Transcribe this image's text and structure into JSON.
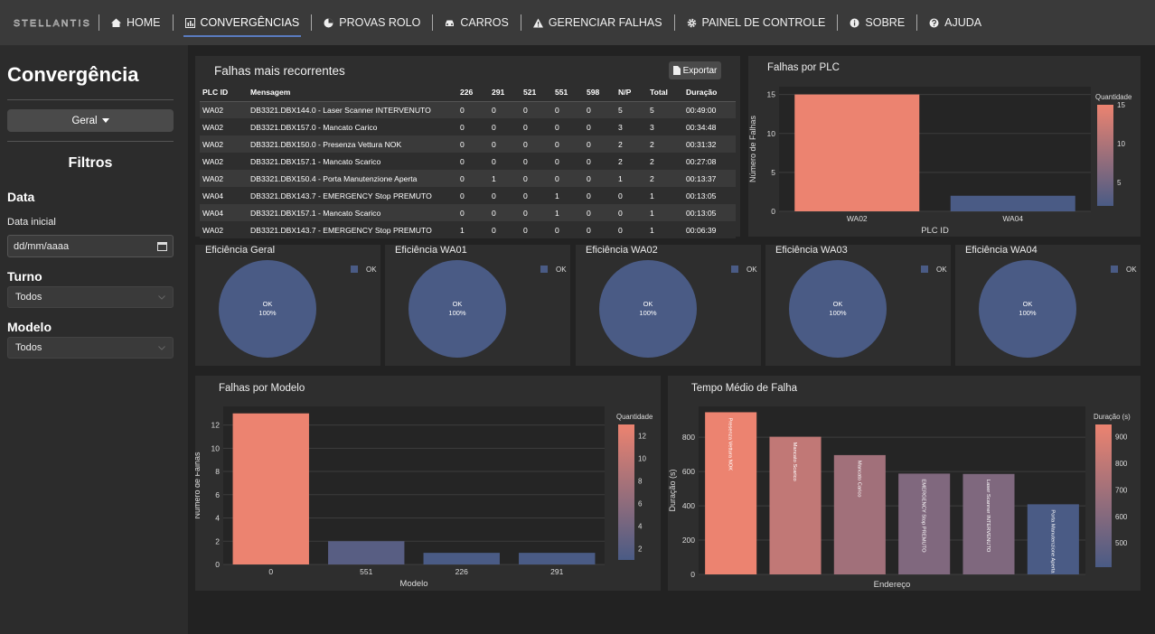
{
  "nav": {
    "logo_text": "STELLANTIS",
    "items": [
      {
        "label": "HOME",
        "icon": "home-icon"
      },
      {
        "label": "CONVERGÊNCIAS",
        "icon": "chart-icon"
      },
      {
        "label": "PROVAS ROLO",
        "icon": "pie-icon"
      },
      {
        "label": "CARROS",
        "icon": "car-icon"
      },
      {
        "label": "GERENCIAR FALHAS",
        "icon": "warning-icon"
      },
      {
        "label": "PAINEL DE CONTROLE",
        "icon": "gear-icon"
      },
      {
        "label": "SOBRE",
        "icon": "info-icon"
      },
      {
        "label": "AJUDA",
        "icon": "question-icon"
      }
    ],
    "active": "CONVERGÊNCIAS"
  },
  "sidebar": {
    "title": "Convergência",
    "view_dropdown": "Geral",
    "filters_title": "Filtros",
    "date_label": "Data",
    "date_start_label": "Data inicial",
    "date_placeholder": "dd/mm/aaaa",
    "shift_label": "Turno",
    "shift_value": "Todos",
    "model_label": "Modelo",
    "model_value": "Todos"
  },
  "table_card": {
    "title": "Falhas mais recorrentes",
    "export_label": "Exportar",
    "columns": [
      "PLC ID",
      "Mensagem",
      "226",
      "291",
      "521",
      "551",
      "598",
      "N/P",
      "Total",
      "Duração"
    ],
    "rows": [
      [
        "WA02",
        "DB3321.DBX144.0 - Laser Scanner INTERVENUTO",
        "0",
        "0",
        "0",
        "0",
        "0",
        "5",
        "5",
        "00:49:00"
      ],
      [
        "WA02",
        "DB3321.DBX157.0 - Mancato Carico",
        "0",
        "0",
        "0",
        "0",
        "0",
        "3",
        "3",
        "00:34:48"
      ],
      [
        "WA02",
        "DB3321.DBX150.0 - Presenza Vettura NOK",
        "0",
        "0",
        "0",
        "0",
        "0",
        "2",
        "2",
        "00:31:32"
      ],
      [
        "WA02",
        "DB3321.DBX157.1 - Mancato Scarico",
        "0",
        "0",
        "0",
        "0",
        "0",
        "2",
        "2",
        "00:27:08"
      ],
      [
        "WA02",
        "DB3321.DBX150.4 - Porta Manutenzione Aperta",
        "0",
        "1",
        "0",
        "0",
        "0",
        "1",
        "2",
        "00:13:37"
      ],
      [
        "WA04",
        "DB3321.DBX143.7 - EMERGENCY Stop PREMUTO",
        "0",
        "0",
        "0",
        "1",
        "0",
        "0",
        "1",
        "00:13:05"
      ],
      [
        "WA04",
        "DB3321.DBX157.1 - Mancato Scarico",
        "0",
        "0",
        "0",
        "1",
        "0",
        "0",
        "1",
        "00:13:05"
      ],
      [
        "WA02",
        "DB3321.DBX143.7 - EMERGENCY Stop PREMUTO",
        "1",
        "0",
        "0",
        "0",
        "0",
        "0",
        "1",
        "00:06:39"
      ]
    ]
  },
  "colors": {
    "high": "#ec8370",
    "low": "#4a5b85"
  },
  "chart_data": [
    {
      "type": "bar",
      "title": "Falhas por PLC",
      "categories": [
        "WA02",
        "WA04"
      ],
      "values": [
        15,
        2
      ],
      "xlabel": "PLC ID",
      "ylabel": "Número de Falhas",
      "ylim": [
        0,
        16
      ],
      "yticks": [
        0,
        5,
        10,
        15
      ],
      "colorbar": {
        "title": "Quantidade",
        "range": [
          2,
          15
        ],
        "ticks": [
          5,
          10,
          15
        ]
      },
      "grid": true
    },
    {
      "type": "pie",
      "title": "Eficiência Geral",
      "slices": [
        {
          "label": "OK",
          "value": 100,
          "text": "100%"
        }
      ],
      "legend": [
        "OK"
      ]
    },
    {
      "type": "pie",
      "title": "Eficiência WA01",
      "slices": [
        {
          "label": "OK",
          "value": 100,
          "text": "100%"
        }
      ],
      "legend": [
        "OK"
      ]
    },
    {
      "type": "pie",
      "title": "Eficiência WA02",
      "slices": [
        {
          "label": "OK",
          "value": 100,
          "text": "100%"
        }
      ],
      "legend": [
        "OK"
      ]
    },
    {
      "type": "pie",
      "title": "Eficiência WA03",
      "slices": [
        {
          "label": "OK",
          "value": 100,
          "text": "100%"
        }
      ],
      "legend": [
        "OK"
      ]
    },
    {
      "type": "pie",
      "title": "Eficiência WA04",
      "slices": [
        {
          "label": "OK",
          "value": 100,
          "text": "100%"
        }
      ],
      "legend": [
        "OK"
      ]
    },
    {
      "type": "bar",
      "title": "Falhas por Modelo",
      "categories": [
        "0",
        "551",
        "226",
        "291"
      ],
      "values": [
        13,
        2,
        1,
        1
      ],
      "xlabel": "Modelo",
      "ylabel": "Número de Falhas",
      "ylim": [
        0,
        13.6
      ],
      "yticks": [
        0,
        2,
        4,
        6,
        8,
        10,
        12
      ],
      "colorbar": {
        "title": "Quantidade",
        "range": [
          1,
          13
        ],
        "ticks": [
          2,
          4,
          6,
          8,
          10,
          12
        ]
      },
      "grid": true
    },
    {
      "type": "bar",
      "title": "Tempo Médio de Falha",
      "categories": [
        "Presenza Vettura NOK",
        "Mancato Scarico",
        "Mancato Carico",
        "EMERGENCY Stop PREMUTO",
        "Laser Scanner INTERVENUTO",
        "Porta Manutenzione Aperta"
      ],
      "values": [
        946,
        803,
        696,
        588,
        586,
        409
      ],
      "xlabel": "Endereço",
      "ylabel": "Duração (s)",
      "ylim": [
        0,
        980
      ],
      "yticks": [
        0,
        200,
        400,
        600,
        800
      ],
      "colorbar": {
        "title": "Duração (s)",
        "range": [
          409,
          946
        ],
        "ticks": [
          500,
          600,
          700,
          800,
          900
        ]
      },
      "grid": true
    }
  ]
}
